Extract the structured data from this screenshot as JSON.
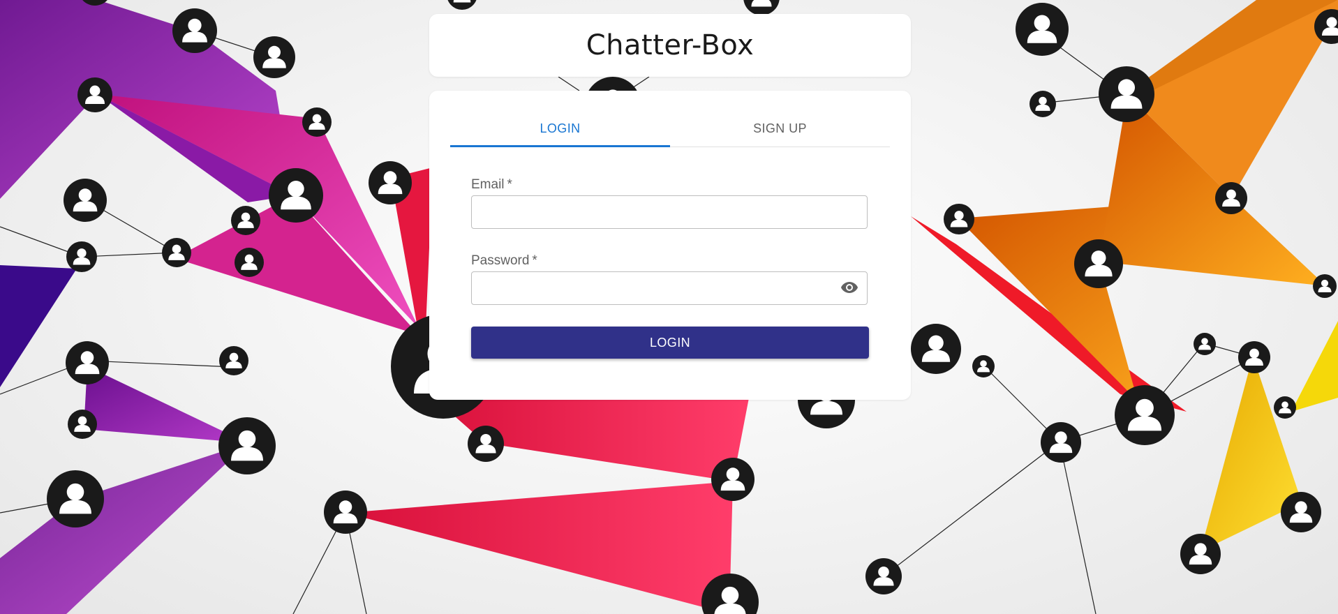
{
  "app": {
    "title": "Chatter-Box"
  },
  "tabs": [
    {
      "label": "LOGIN",
      "active": true
    },
    {
      "label": "SIGN UP",
      "active": false
    }
  ],
  "form": {
    "email_label": "Email",
    "password_label": "Password",
    "required_mark": "*",
    "email_value": "",
    "password_value": "",
    "submit_label": "LOGIN"
  },
  "icons": {
    "password_toggle": "eye-icon",
    "background_nodes": "user-avatar-icon"
  },
  "colors": {
    "accent_tab": "#1976d2",
    "primary_button": "#303189",
    "node_fill": "#1a1a1a",
    "purple": "#8e24aa",
    "magenta": "#d81b8c",
    "red": "#e5173f",
    "orange": "#f08a1c",
    "yellow": "#f5c518"
  }
}
